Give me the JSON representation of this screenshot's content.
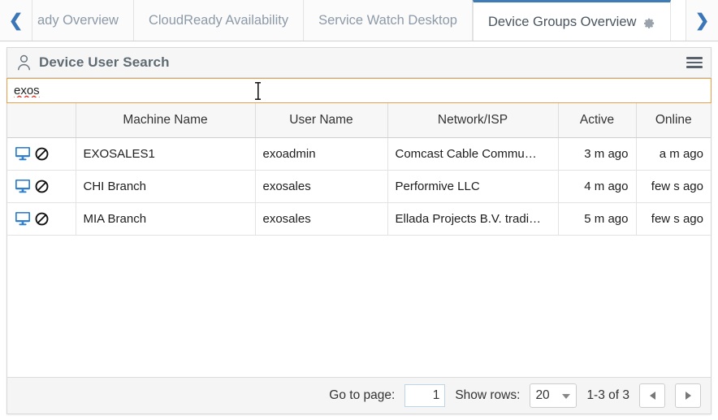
{
  "tabbar": {
    "prev_arrow": "❮",
    "next_arrow": "❯",
    "tabs": [
      {
        "label": "ady Overview",
        "active": false,
        "gear": false
      },
      {
        "label": "CloudReady Availability",
        "active": false,
        "gear": false
      },
      {
        "label": "Service Watch Desktop",
        "active": false,
        "gear": false
      },
      {
        "label": "Device Groups Overview",
        "active": true,
        "gear": true
      }
    ]
  },
  "panel": {
    "title": "Device User Search",
    "title_icon": "user-icon",
    "menu_icon": "hamburger-icon"
  },
  "search": {
    "value": "exos",
    "placeholder": ""
  },
  "table": {
    "columns": [
      "",
      "Machine Name",
      "User Name",
      "Network/ISP",
      "Active",
      "Online"
    ],
    "rows": [
      {
        "machine_name": "EXOSALES1",
        "user_name": "exoadmin",
        "network_isp": "Comcast Cable Commu…",
        "active": "3 m ago",
        "online": "a m ago"
      },
      {
        "machine_name": "CHI Branch",
        "user_name": "exosales",
        "network_isp": "Performive LLC",
        "active": "4 m ago",
        "online": "few s ago"
      },
      {
        "machine_name": "MIA Branch",
        "user_name": "exosales",
        "network_isp": "Ellada Projects B.V. tradi…",
        "active": "5 m ago",
        "online": "few s ago"
      }
    ]
  },
  "footer": {
    "goto_label": "Go to page:",
    "page_value": "1",
    "showrows_label": "Show rows:",
    "rows_value": "20",
    "range_label": "1-3 of 3",
    "prev_page": "◀",
    "next_page": "▶"
  },
  "colors": {
    "accent_blue": "#3f7cb6",
    "focus_orange": "#e8a34a",
    "icon_blue": "#2f7fd0",
    "spellcheck_red": "#e23b2e"
  }
}
